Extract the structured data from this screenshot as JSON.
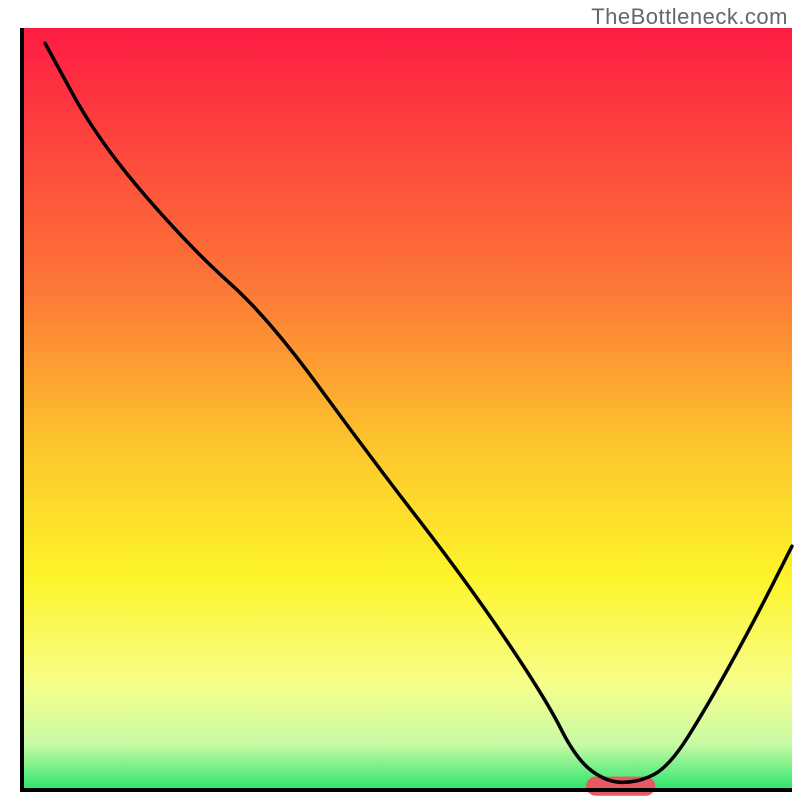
{
  "watermark": "TheBottleneck.com",
  "chart_data": {
    "type": "line",
    "title": "",
    "xlabel": "",
    "ylabel": "",
    "xlim": [
      0,
      100
    ],
    "ylim": [
      0,
      100
    ],
    "background_gradient": {
      "top": "#fd1c43",
      "mid_upper": "#fdaa32",
      "mid": "#fdf42a",
      "mid_lower": "#f7fe8a",
      "lower": "#c8fba5",
      "bottom": "#2ae46c"
    },
    "series": [
      {
        "name": "bottleneck-curve",
        "color": "#000000",
        "x": [
          3,
          10,
          22,
          32,
          45,
          58,
          68,
          72,
          76,
          80,
          84,
          89,
          95,
          100
        ],
        "y": [
          98,
          85,
          71,
          62,
          44,
          27,
          12,
          4,
          1,
          1,
          3,
          11,
          22,
          32
        ]
      }
    ],
    "marker": {
      "name": "optimal-zone",
      "x_start": 74.5,
      "x_end": 81,
      "y": 0.5,
      "color": "#e75a5f",
      "thickness": 2.5
    },
    "axes": {
      "show_ticks": false,
      "show_gridlines": false,
      "border_color": "#000000",
      "border_width": 4
    }
  }
}
